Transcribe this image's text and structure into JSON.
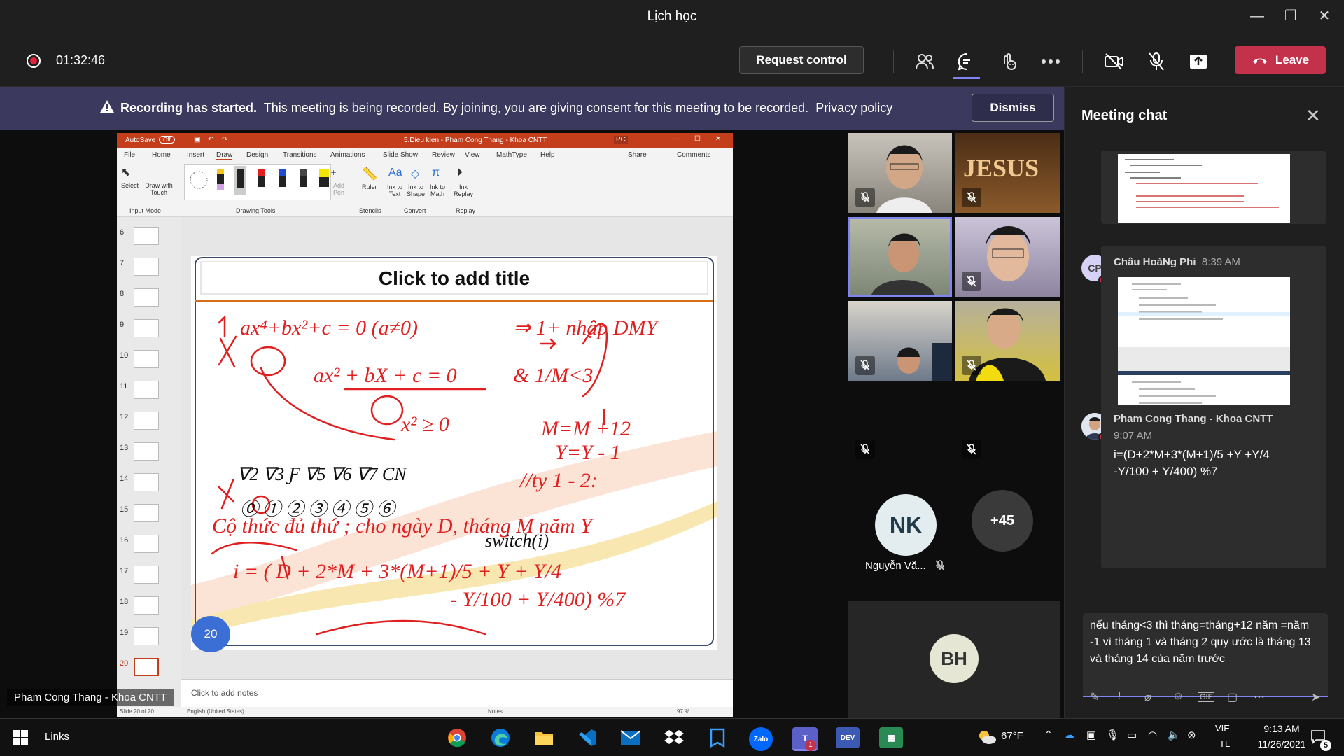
{
  "window": {
    "title": "Lịch học"
  },
  "meeting_bar": {
    "timer": "01:32:46",
    "request_control_label": "Request control",
    "leave_label": "Leave",
    "icons": [
      "participants-icon",
      "chat-icon",
      "reactions-icon",
      "more-options-icon",
      "camera-off-icon",
      "mic-off-icon",
      "share-icon"
    ]
  },
  "banner": {
    "bold_text": "Recording has started.",
    "text": "This meeting is being recorded. By joining, you are giving consent for this meeting to be recorded.",
    "link": "Privacy policy",
    "dismiss_label": "Dismiss"
  },
  "presentation": {
    "app_title": "5.Dieu kien - Pham Cong Thang - Khoa CNTT",
    "autosave_label": "AutoSave",
    "autosave_state": "Off",
    "owner_badge": "PC",
    "menu": [
      "File",
      "Home",
      "Insert",
      "Draw",
      "Design",
      "Transitions",
      "Animations",
      "Slide Show",
      "Review",
      "View",
      "MathType",
      "Help"
    ],
    "share_label": "Share",
    "comments_label": "Comments",
    "ribbon_items": [
      "Select",
      "Draw with Touch",
      "Add Pen",
      "Ruler",
      "Ink to Text",
      "Ink to Shape",
      "Ink to Math",
      "Ink Replay"
    ],
    "ribbon_groups": [
      "Input Mode",
      "Drawing Tools",
      "Stencils",
      "Convert",
      "Replay"
    ],
    "thumbnails": [
      "6",
      "7",
      "8",
      "9",
      "10",
      "11",
      "12",
      "13",
      "14",
      "15",
      "16",
      "17",
      "18",
      "19",
      "20"
    ],
    "slide_title": "Click to add title",
    "notes_placeholder": "Click to add notes",
    "status_left": "Slide 20 of 20",
    "status_lang": "English (United States)",
    "status_notes": "Notes",
    "status_zoom": "97 %",
    "slide_number": "20"
  },
  "presenter_label": "Pham Cong Thang - Khoa CNTT",
  "participants": {
    "nk_initials": "NK",
    "nk_name": "Nguyễn Vă...",
    "more_count": "+45",
    "bh_initials": "BH"
  },
  "chat": {
    "title": "Meeting chat",
    "messages": [
      {
        "avatar": "CP",
        "sender": "Châu HoàNg Phi",
        "time": "8:39 AM"
      },
      {
        "sender": "Pham Cong Thang - Khoa CNTT",
        "time": "9:07 AM",
        "text_line1": "i=(D+2*M+3*(M+1)/5 +Y +Y/4",
        "text_line2": "-Y/100 + Y/400) %7"
      }
    ],
    "compose_text": "nếu tháng<3 thì tháng=tháng+12 năm =năm -1 vì tháng 1 và tháng 2 quy ước là tháng 13 và tháng 14 của năm trước",
    "compose_tools": [
      "format-icon",
      "priority-icon",
      "attach-icon",
      "emoji-icon",
      "gif-icon",
      "sticker-icon",
      "more-icon",
      "send-icon"
    ]
  },
  "taskbar": {
    "links_label": "Links",
    "weather": "67°F",
    "lang_line1": "VIE",
    "lang_line2": "TL",
    "time": "9:13 AM",
    "date": "11/26/2021",
    "notification_count": "5",
    "apps": [
      "chrome-icon",
      "edge-icon",
      "file-explorer-icon",
      "vscode-icon",
      "mail-icon",
      "dropbox-icon",
      "app-icon",
      "zalo-icon",
      "teams-icon",
      "devcpp-icon",
      "app2-icon"
    ],
    "colors": {
      "teams_purple": "#5b5fc7",
      "leave_red": "#c4314b",
      "banner": "#3b3a5e"
    }
  }
}
